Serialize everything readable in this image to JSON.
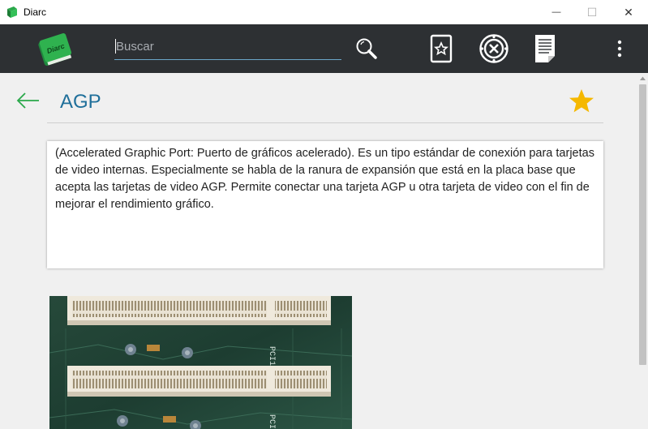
{
  "window": {
    "title": "Diarc",
    "minimize_glyph": "—",
    "maximize_glyph": "☐",
    "close_glyph": "✕"
  },
  "toolbar": {
    "logo_text": "Diarc",
    "search": {
      "placeholder": "Buscar",
      "value": ""
    },
    "icons": [
      "search-icon",
      "bookmark-star-icon",
      "random-dice-icon",
      "list-document-icon",
      "more-vertical-icon"
    ]
  },
  "term": {
    "title": "AGP",
    "favorite": true,
    "definition": "(Accelerated Graphic Port: Puerto de gráficos acelerado). Es un tipo estándar de conexión para tarjetas de video internas. Especialmente se habla de la ranura de expansión que está en la placa base que acepta las tarjetas de video AGP. Permite conectar una tarjeta AGP u otra tarjeta de video con el fin de mejorar el rendimiento gráfico.",
    "image_labels": [
      "PCI1",
      "PCI2"
    ]
  },
  "colors": {
    "toolbar_bg": "#2d3033",
    "accent_green": "#2aa84a",
    "title_blue": "#1f6f9a",
    "star_yellow": "#f5b800",
    "search_underline": "#6aa6c8"
  }
}
